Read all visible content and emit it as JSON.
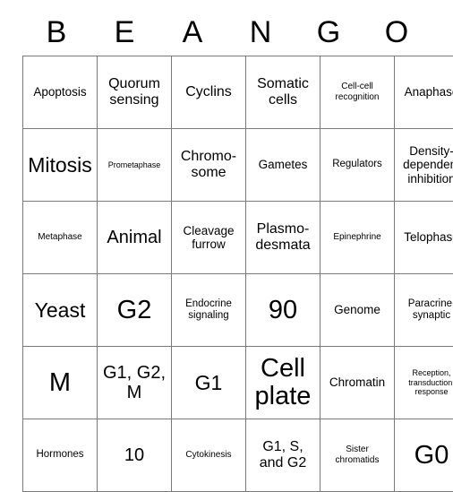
{
  "card": {
    "columns": 6,
    "rows": 6,
    "border_color": "#7a7a7a",
    "background_color": "#ffffff",
    "text_color": "#000000",
    "header": {
      "letters": [
        "B",
        "E",
        "A",
        "N",
        "G",
        "O"
      ]
    },
    "grid": [
      [
        {
          "text": "Apoptosis",
          "size": "fs-m"
        },
        {
          "text": "Quorum sensing",
          "size": "fs-l"
        },
        {
          "text": "Cyclins",
          "size": "fs-l"
        },
        {
          "text": "Somatic cells",
          "size": "fs-l"
        },
        {
          "text": "Cell-cell recognition",
          "size": "fs-xs"
        },
        {
          "text": "Anaphase",
          "size": "fs-m"
        }
      ],
      [
        {
          "text": "Mitosis",
          "size": "fs-2xl"
        },
        {
          "text": "Prometaphase",
          "size": "fs-xxs"
        },
        {
          "text": "Chromo-some",
          "size": "fs-l"
        },
        {
          "text": "Gametes",
          "size": "fs-m"
        },
        {
          "text": "Regulators",
          "size": "fs-s"
        },
        {
          "text": "Density-dependent inhibition",
          "size": "fs-m"
        }
      ],
      [
        {
          "text": "Metaphase",
          "size": "fs-xs"
        },
        {
          "text": "Animal",
          "size": "fs-xl"
        },
        {
          "text": "Cleavage furrow",
          "size": "fs-m"
        },
        {
          "text": "Plasmo-desmata",
          "size": "fs-l"
        },
        {
          "text": "Epinephrine",
          "size": "fs-xs"
        },
        {
          "text": "Telophase",
          "size": "fs-m"
        }
      ],
      [
        {
          "text": "Yeast",
          "size": "fs-2xl"
        },
        {
          "text": "G2",
          "size": "fs-3xl"
        },
        {
          "text": "Endocrine signaling",
          "size": "fs-s"
        },
        {
          "text": "90",
          "size": "fs-3xl"
        },
        {
          "text": "Genome",
          "size": "fs-m"
        },
        {
          "text": "Paracrine, synaptic",
          "size": "fs-s"
        }
      ],
      [
        {
          "text": "M",
          "size": "fs-3xl"
        },
        {
          "text": "G1, G2, M",
          "size": "fs-xl"
        },
        {
          "text": "G1",
          "size": "fs-2xl"
        },
        {
          "text": "Cell plate",
          "size": "fs-3xl"
        },
        {
          "text": "Chromatin",
          "size": "fs-m"
        },
        {
          "text": "Reception, transduction, response",
          "size": "fs-xxs"
        }
      ],
      [
        {
          "text": "Hormones",
          "size": "fs-s"
        },
        {
          "text": "10",
          "size": "fs-xl"
        },
        {
          "text": "Cytokinesis",
          "size": "fs-xs"
        },
        {
          "text": "G1, S, and G2",
          "size": "fs-l"
        },
        {
          "text": "Sister chromatids",
          "size": "fs-xs"
        },
        {
          "text": "G0",
          "size": "fs-3xl"
        }
      ]
    ]
  }
}
